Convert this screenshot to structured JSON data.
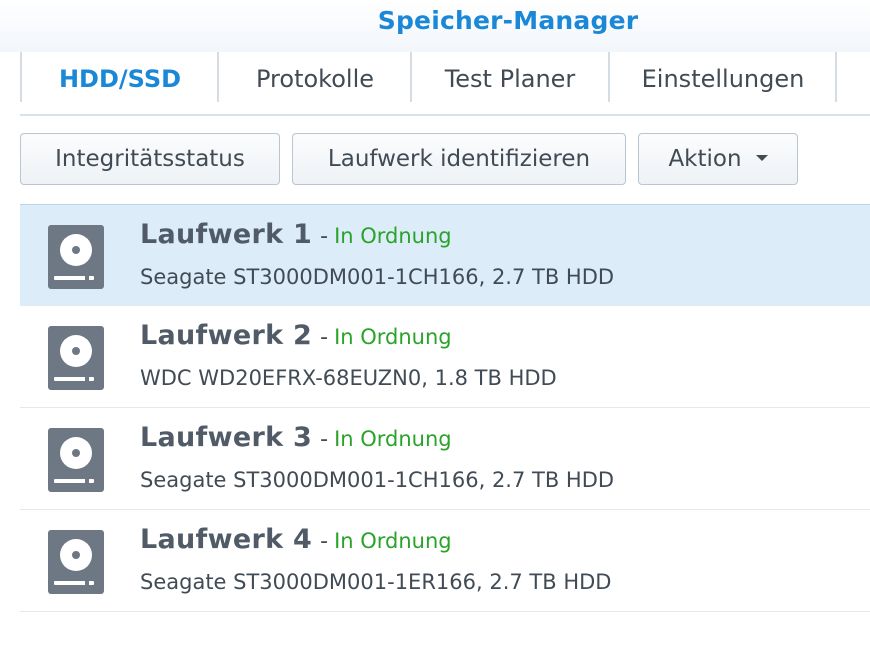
{
  "app": {
    "title": "Speicher-Manager"
  },
  "tabs": [
    {
      "label": "HDD/SSD",
      "active": true
    },
    {
      "label": "Protokolle",
      "active": false
    },
    {
      "label": "Test Planer",
      "active": false
    },
    {
      "label": "Einstellungen",
      "active": false
    }
  ],
  "toolbar": {
    "integrity_label": "Integritätsstatus",
    "identify_label": "Laufwerk identifizieren",
    "action_label": "Aktion"
  },
  "drives": [
    {
      "name": "Laufwerk 1",
      "separator": "-",
      "status": "In Ordnung",
      "model": "Seagate ST3000DM001-1CH166, 2.7 TB HDD",
      "selected": true,
      "icon": "hdd-icon"
    },
    {
      "name": "Laufwerk 2",
      "separator": "-",
      "status": "In Ordnung",
      "model": "WDC WD20EFRX-68EUZN0, 1.8 TB HDD",
      "selected": false,
      "icon": "hdd-icon"
    },
    {
      "name": "Laufwerk 3",
      "separator": "-",
      "status": "In Ordnung",
      "model": "Seagate ST3000DM001-1CH166, 2.7 TB HDD",
      "selected": false,
      "icon": "hdd-icon"
    },
    {
      "name": "Laufwerk 4",
      "separator": "-",
      "status": "In Ordnung",
      "model": "Seagate ST3000DM001-1ER166, 2.7 TB HDD",
      "selected": false,
      "icon": "hdd-icon"
    }
  ],
  "colors": {
    "accent": "#1b88d7",
    "status_ok": "#29a329",
    "selected_row": "#dcecf8",
    "icon": "#6e7884"
  }
}
